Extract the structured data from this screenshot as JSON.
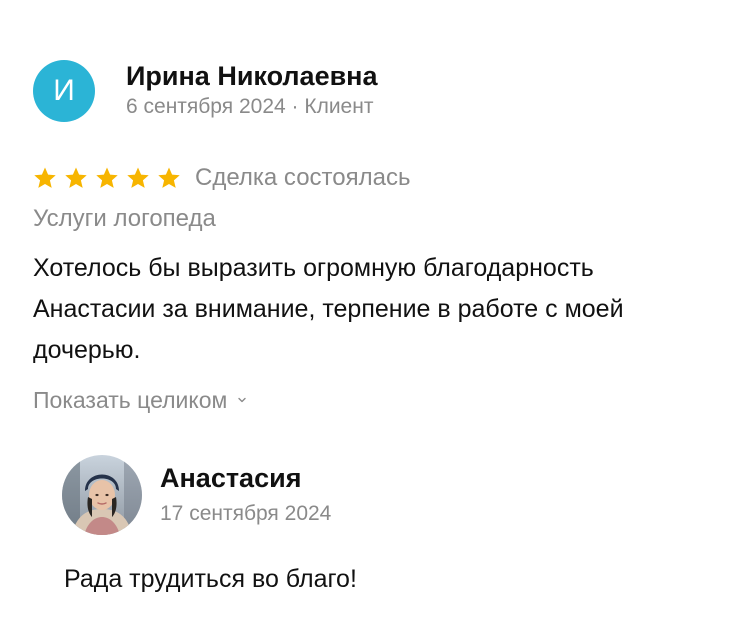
{
  "review": {
    "avatar_letter": "И",
    "author": "Ирина Николаевна",
    "meta": "6 сентября 2024 · Клиент",
    "rating": 5,
    "rating_max": 5,
    "star_color": "#f7b500",
    "deal_status": "Сделка состоялась",
    "service": "Услуги логопеда",
    "text": "Хотелось бы выразить огромную благодарность Анастасии за внимание, терпение в работе с моей дочерью.",
    "show_more": "Показать целиком",
    "avatar_color": "#2bb4d6"
  },
  "reply": {
    "author": "Анастасия",
    "date": "17 сентября 2024",
    "text": "Рада трудиться во благо!"
  }
}
